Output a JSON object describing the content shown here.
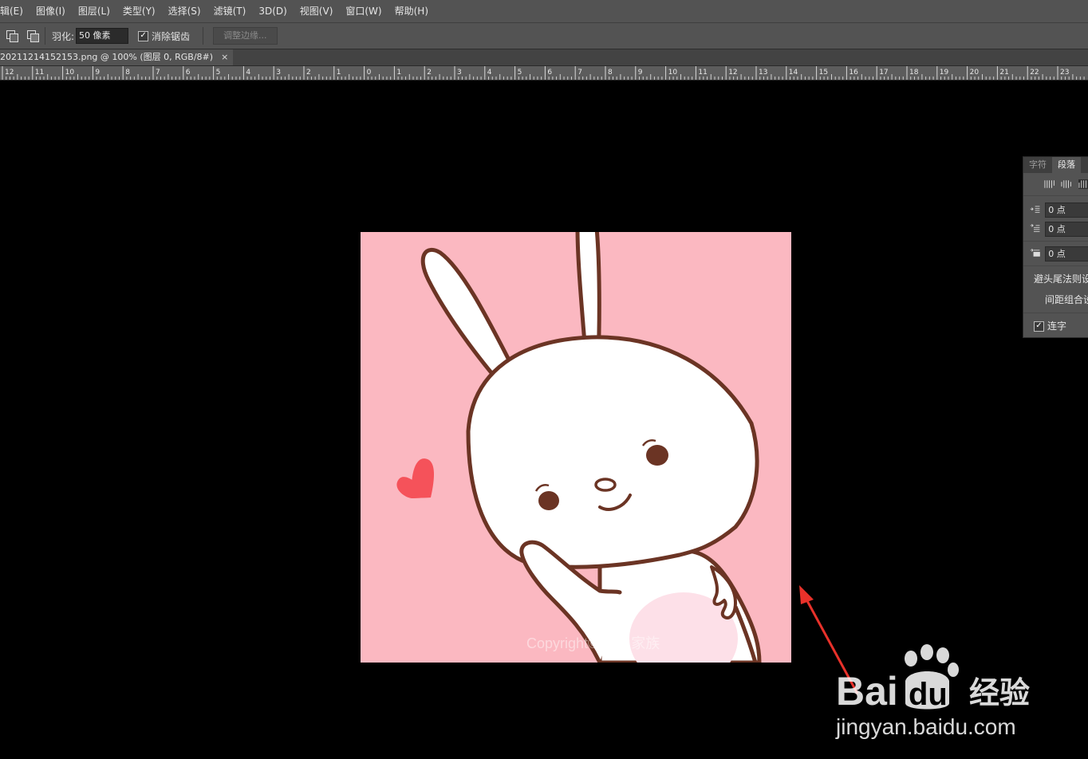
{
  "menubar": {
    "items": [
      "辑(E)",
      "图像(I)",
      "图层(L)",
      "类型(Y)",
      "选择(S)",
      "滤镜(T)",
      "3D(D)",
      "视图(V)",
      "窗口(W)",
      "帮助(H)"
    ]
  },
  "options": {
    "feather_label": "羽化:",
    "feather_value": "50 像素",
    "antialias_label": "消除锯齿",
    "refine_edge_button": "调整边缘..."
  },
  "document": {
    "tab_title": "20211214152153.png @ 100% (图层 0, RGB/8#)",
    "close_glyph": "×",
    "watermark_text": "Copyright© 萌兔家族"
  },
  "ruler": {
    "labels": [
      "12",
      "11",
      "10",
      "9",
      "8",
      "7",
      "6",
      "5",
      "4",
      "3",
      "2",
      "1",
      "0",
      "1",
      "2",
      "3",
      "4",
      "5",
      "6",
      "7",
      "8",
      "9",
      "10",
      "11",
      "12",
      "13",
      "14",
      "15",
      "16",
      "17",
      "18",
      "19",
      "20",
      "21",
      "22",
      "23"
    ]
  },
  "paragraph_panel": {
    "tabs": [
      "字符",
      "段落"
    ],
    "indent_left": "0 点",
    "indent_first": "0 点",
    "space_before": "0 点",
    "kinsoku_label": "避头尾法则设",
    "mojikumi_label": "间距组合设",
    "hyphenate_label": "连字"
  },
  "site_watermark": {
    "logo_text_left": "Bai",
    "logo_text_right": "du",
    "logo_cn": "经验",
    "url": "jingyan.baidu.com"
  },
  "colors": {
    "background": "#000000",
    "ui_gray": "#535353",
    "image_pink": "#fbb8c1",
    "outline_brown": "#6b3424",
    "annotation_red": "#e8312a"
  }
}
